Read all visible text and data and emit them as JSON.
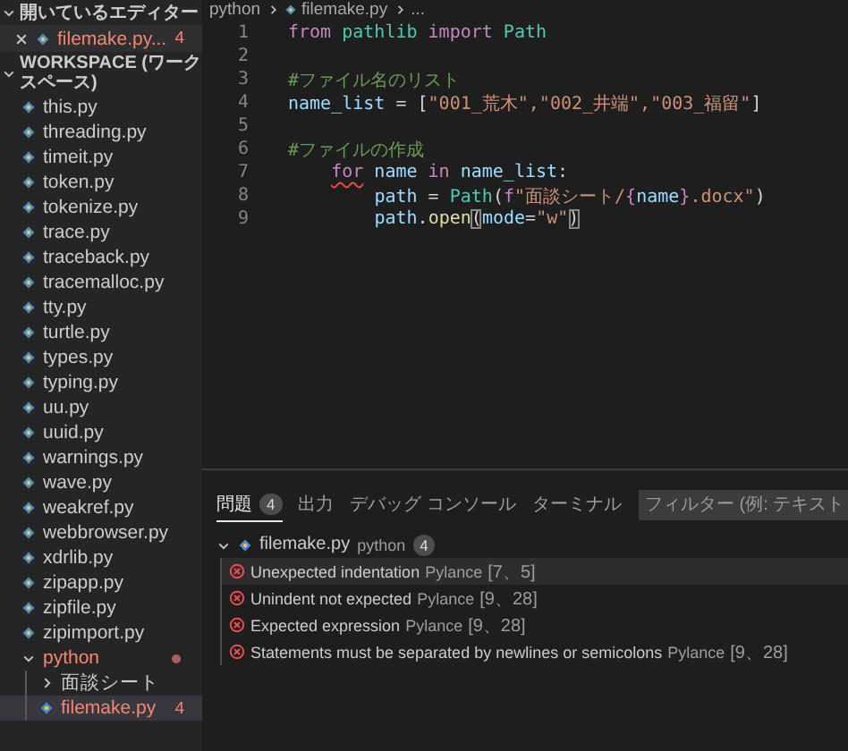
{
  "sidebar": {
    "open_editors": {
      "title": "開いているエディター",
      "expanded": true,
      "files": [
        {
          "name": "filemake.py...",
          "error": true,
          "badge": "4"
        }
      ]
    },
    "workspace": {
      "title": "WORKSPACE (ワークスペース)",
      "expanded": true,
      "children": [
        {
          "kind": "file",
          "name": "this.py"
        },
        {
          "kind": "file",
          "name": "threading.py"
        },
        {
          "kind": "file",
          "name": "timeit.py"
        },
        {
          "kind": "file",
          "name": "token.py"
        },
        {
          "kind": "file",
          "name": "tokenize.py"
        },
        {
          "kind": "file",
          "name": "trace.py"
        },
        {
          "kind": "file",
          "name": "traceback.py"
        },
        {
          "kind": "file",
          "name": "tracemalloc.py"
        },
        {
          "kind": "file",
          "name": "tty.py"
        },
        {
          "kind": "file",
          "name": "turtle.py"
        },
        {
          "kind": "file",
          "name": "types.py"
        },
        {
          "kind": "file",
          "name": "typing.py"
        },
        {
          "kind": "file",
          "name": "uu.py"
        },
        {
          "kind": "file",
          "name": "uuid.py"
        },
        {
          "kind": "file",
          "name": "warnings.py"
        },
        {
          "kind": "file",
          "name": "wave.py"
        },
        {
          "kind": "file",
          "name": "weakref.py"
        },
        {
          "kind": "file",
          "name": "webbrowser.py"
        },
        {
          "kind": "file",
          "name": "xdrlib.py"
        },
        {
          "kind": "file",
          "name": "zipapp.py"
        },
        {
          "kind": "file",
          "name": "zipfile.py"
        },
        {
          "kind": "file",
          "name": "zipimport.py"
        },
        {
          "kind": "folder",
          "name": "python",
          "expanded": true,
          "error": true,
          "children": [
            {
              "kind": "folder",
              "name": "面談シート",
              "expanded": false
            },
            {
              "kind": "file",
              "name": "filemake.py",
              "error": true,
              "badge": "4",
              "selected": true
            }
          ]
        }
      ]
    }
  },
  "editor": {
    "breadcrumb": [
      "python",
      "filemake.py",
      "..."
    ],
    "lines": [
      {
        "number": "1",
        "tokens": [
          {
            "text": "from",
            "kind": "keyword"
          },
          {
            "text": " pathlib ",
            "kind": "module"
          },
          {
            "text": "import",
            "kind": "keyword"
          },
          {
            "text": " Path",
            "kind": "class"
          }
        ]
      },
      {
        "number": "2"
      },
      {
        "number": "3",
        "tokens": [
          {
            "text": "#ファイル名のリスト",
            "kind": "comment"
          }
        ]
      },
      {
        "number": "4",
        "tokens": [
          {
            "text": "name_list",
            "kind": "variable"
          },
          {
            "text": " = [",
            "kind": "plain"
          },
          {
            "text": "\"001_荒木\",\"002_井端\",\"003_福留\"",
            "kind": "string"
          },
          {
            "text": "]",
            "kind": "plain"
          }
        ]
      },
      {
        "number": "5"
      },
      {
        "number": "6",
        "tokens": [
          {
            "text": "#ファイルの作成",
            "kind": "comment"
          }
        ]
      },
      {
        "number": "7",
        "indented": true,
        "tokens": [
          {
            "text": "for",
            "kind": "keyword",
            "error": true
          },
          {
            "text": " name ",
            "kind": "variable"
          },
          {
            "text": "in",
            "kind": "keyword"
          },
          {
            "text": " name_list",
            "kind": "variable"
          },
          {
            "text": ":",
            "kind": "plain"
          }
        ],
        "children": [
          {
            "number": "8",
            "tokens": [
              {
                "text": "path",
                "kind": "variable"
              },
              {
                "text": " = ",
                "kind": "plain"
              },
              {
                "text": "Path",
                "kind": "class"
              },
              {
                "text": "(",
                "kind": "plain"
              },
              {
                "text": "f",
                "kind": "keyword"
              },
              {
                "text": "\"面談シート/",
                "kind": "string"
              },
              {
                "text": "{",
                "kind": "keyword"
              },
              {
                "text": "name",
                "kind": "variable"
              },
              {
                "text": "}",
                "kind": "keyword"
              },
              {
                "text": ".docx\"",
                "kind": "string"
              },
              {
                "text": ")",
                "kind": "plain"
              }
            ]
          },
          {
            "number": "9",
            "tokens": [
              {
                "text": "path",
                "kind": "variable"
              },
              {
                "text": ".",
                "kind": "plain"
              },
              {
                "text": "open",
                "kind": "function"
              },
              {
                "text": "(",
                "kind": "bracket-match"
              },
              {
                "text": "mode",
                "kind": "variable"
              },
              {
                "text": "=",
                "kind": "plain"
              },
              {
                "text": "\"w\"",
                "kind": "string"
              },
              {
                "text": ")",
                "kind": "bracket-match"
              }
            ]
          }
        ]
      }
    ]
  },
  "panel": {
    "tabs": [
      {
        "label": "問題",
        "badge": "4",
        "selected": true
      },
      {
        "label": "出力",
        "selected": false
      },
      {
        "label": "デバッグ コンソール",
        "selected": false
      },
      {
        "label": "ターミナル",
        "selected": false
      }
    ],
    "filter": {
      "placeholder": "フィルター (例: テキスト"
    },
    "problems": [
      {
        "file": "filemake.py",
        "folder": "python",
        "count": "4",
        "expanded": true,
        "items": [
          {
            "message": "Unexpected indentation",
            "source": "Pylance",
            "position": "[7、5]",
            "selected": true
          },
          {
            "message": "Unindent not expected",
            "source": "Pylance",
            "position": "[9、28]",
            "selected": false
          },
          {
            "message": "Expected expression",
            "source": "Pylance",
            "position": "[9、28]",
            "selected": false
          },
          {
            "message": "Statements must be separated by newlines or semicolons",
            "source": "Pylance",
            "position": "[9、28]",
            "selected": false
          }
        ]
      }
    ]
  }
}
